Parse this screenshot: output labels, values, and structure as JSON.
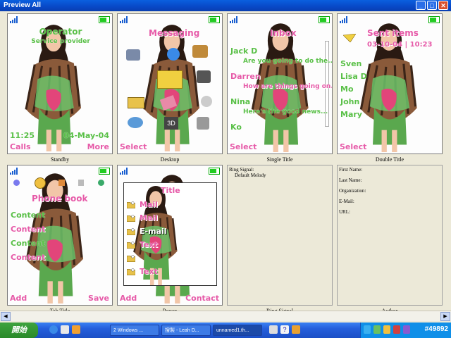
{
  "window": {
    "title": "Preview All",
    "controls": [
      "minimize",
      "maximize",
      "close"
    ]
  },
  "cells": {
    "standby": {
      "caption": "Standby",
      "operator": "Operator",
      "service": "Service provider",
      "time": "11:25",
      "date": "04-May-04",
      "left_soft": "Calls",
      "right_soft": "More"
    },
    "desktop": {
      "caption": "Desktop",
      "heading": "Messaging",
      "left_soft": "Select"
    },
    "single_title": {
      "caption": "Single Title",
      "heading": "Inbox",
      "items": [
        {
          "from": "Jack D",
          "msg": "Are you going to do the..."
        },
        {
          "from": "Darren",
          "msg": "How are things going on..."
        },
        {
          "from": "Nina",
          "msg": "Here's the good news..."
        },
        {
          "from": "Ko",
          "msg": ""
        }
      ],
      "left_soft": "Select"
    },
    "double_title": {
      "caption": "Double Title",
      "heading": "Sent items",
      "subheading": "03-10-04 | 10:23",
      "names": [
        "Sven",
        "Lisa D",
        "Mo",
        "John",
        "Mary"
      ],
      "left_soft": "Select"
    },
    "tab_title": {
      "caption": "Tab Title",
      "heading": "Phone book",
      "contents": [
        "Content",
        "Content",
        "Content",
        "Content"
      ],
      "left_soft": "Add",
      "right_soft": "Save"
    },
    "popup": {
      "caption": "Popup",
      "title": "Title",
      "rows": [
        "Mail",
        "Mail",
        "E-mail",
        "Text",
        "",
        "Text"
      ],
      "left_soft": "Add",
      "right_soft": "Contact"
    },
    "ring_signal": {
      "caption": "Ring Signal",
      "label": "Ring Signal:",
      "value": "Default Melody"
    },
    "author": {
      "caption": "Author",
      "fields": [
        "First Name:",
        "Last Name:",
        "Organization:",
        "E-Mail:",
        "URL:"
      ]
    }
  },
  "taskbar": {
    "start_label": "開始",
    "tasks": [
      "2 Windows ...",
      "搜製 - Leah D...",
      "unnamed1.th..."
    ],
    "clock": "#49892"
  },
  "colors": {
    "titlebar": "#0848c6",
    "pink_text": "#e65aa8",
    "green_text": "#5ac048",
    "taskbar": "#245edb",
    "tray": "#0f8fe8"
  }
}
